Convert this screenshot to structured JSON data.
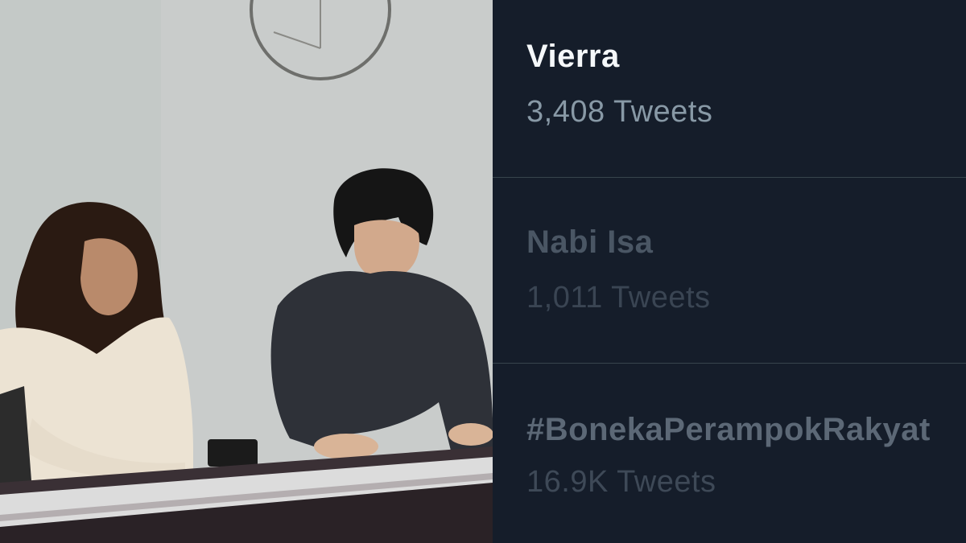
{
  "trends": [
    {
      "name": "Vierra",
      "count": "3,408 Tweets"
    },
    {
      "name": "Nabi Isa",
      "count": "1,011 Tweets"
    },
    {
      "name": "#BonekaPerampokRakyat",
      "count": "16.9K Tweets"
    }
  ],
  "colors": {
    "background": "#151d2a",
    "divider": "#38444d",
    "primary_text": "#f5f8fa",
    "secondary_text": "#8899a6"
  }
}
